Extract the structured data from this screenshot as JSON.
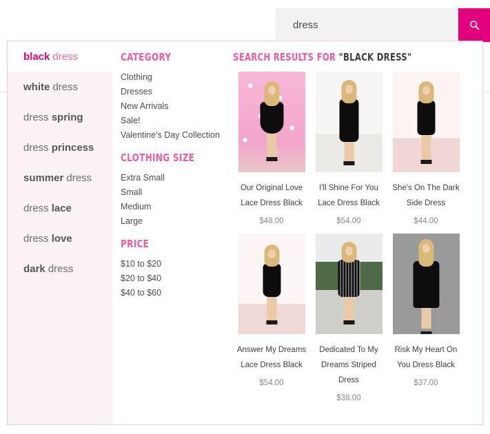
{
  "search": {
    "value": "dress",
    "placeholder": "Search",
    "button_icon": "search-icon",
    "button_color": "#e3007d"
  },
  "theme": {
    "accent": "#e3007d",
    "accent_light": "#ef5ba1",
    "panel_border": "#f2cdd6",
    "suggestion_bg": "#fbf2f3"
  },
  "suggestions": {
    "items": [
      {
        "strong": "black",
        "weak": "dress",
        "strong_first": true,
        "active": true
      },
      {
        "strong": "white",
        "weak": "dress",
        "strong_first": true,
        "active": false
      },
      {
        "strong": "spring",
        "weak": "dress",
        "strong_first": false,
        "active": false
      },
      {
        "strong": "princess",
        "weak": "dress",
        "strong_first": false,
        "active": false
      },
      {
        "strong": "summer",
        "weak": "dress",
        "strong_first": true,
        "active": false
      },
      {
        "strong": "lace",
        "weak": "dress",
        "strong_first": false,
        "active": false
      },
      {
        "strong": "love",
        "weak": "dress",
        "strong_first": false,
        "active": false
      },
      {
        "strong": "dark",
        "weak": "dress",
        "strong_first": true,
        "active": false
      }
    ]
  },
  "filters": {
    "groups": [
      {
        "title": "CATEGORY",
        "items": [
          "Clothing",
          "Dresses",
          "New Arrivals",
          "Sale!",
          "Valentine's Day Collection"
        ]
      },
      {
        "title": "CLOTHING SIZE",
        "items": [
          "Extra Small",
          "Small",
          "Medium",
          "Large"
        ]
      },
      {
        "title": "PRICE",
        "items": [
          "$10 to $20",
          "$20 to $40",
          "$40 to $60"
        ]
      }
    ]
  },
  "results": {
    "heading_prefix": "SEARCH RESULTS FOR ",
    "heading_query": "\"BLACK DRESS\"",
    "products": [
      {
        "title": "Our Original Love Lace Dress Black",
        "price": "$48.00",
        "scene": "bg-pinkfloral",
        "variant": "flare"
      },
      {
        "title": "I'll Shine For You Lace Dress Black",
        "price": "$54.00",
        "scene": "bg-studiowhite",
        "variant": "sheath"
      },
      {
        "title": "She's On The Dark Side Dress",
        "price": "$44.00",
        "scene": "bg-pinkroom",
        "variant": "longsleeve"
      },
      {
        "title": "Answer My Dreams Lace Dress Black",
        "price": "$54.00",
        "scene": "bg-pinkroom2",
        "variant": "lace"
      },
      {
        "title": "Dedicated To My Dreams Striped Dress",
        "price": "$38.00",
        "scene": "bg-outdoor",
        "variant": "striped"
      },
      {
        "title": "Risk My Heart On You Dress Black",
        "price": "$37.00",
        "scene": "bg-graystudio",
        "variant": "tshirt"
      }
    ]
  }
}
